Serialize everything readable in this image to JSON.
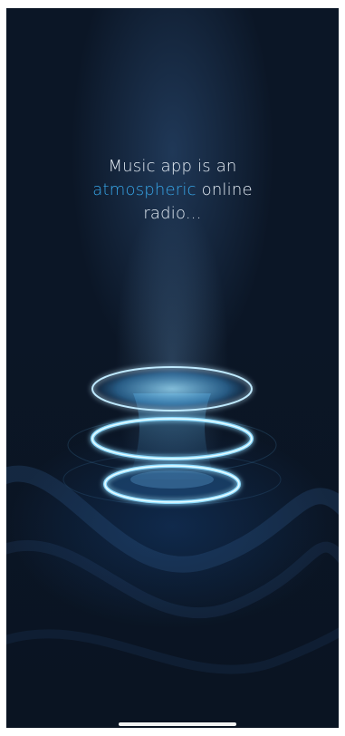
{
  "splash": {
    "tagline_line1": "Music app is an",
    "tagline_accent": "atmospheric",
    "tagline_after_accent": " online",
    "tagline_line3": "radio..."
  },
  "colors": {
    "background": "#0b1626",
    "accent": "#37a6e8",
    "text": "#e6eef6",
    "glow": "#7fd3ff"
  },
  "icons": {
    "hero": "glowing-speaker-icon"
  }
}
